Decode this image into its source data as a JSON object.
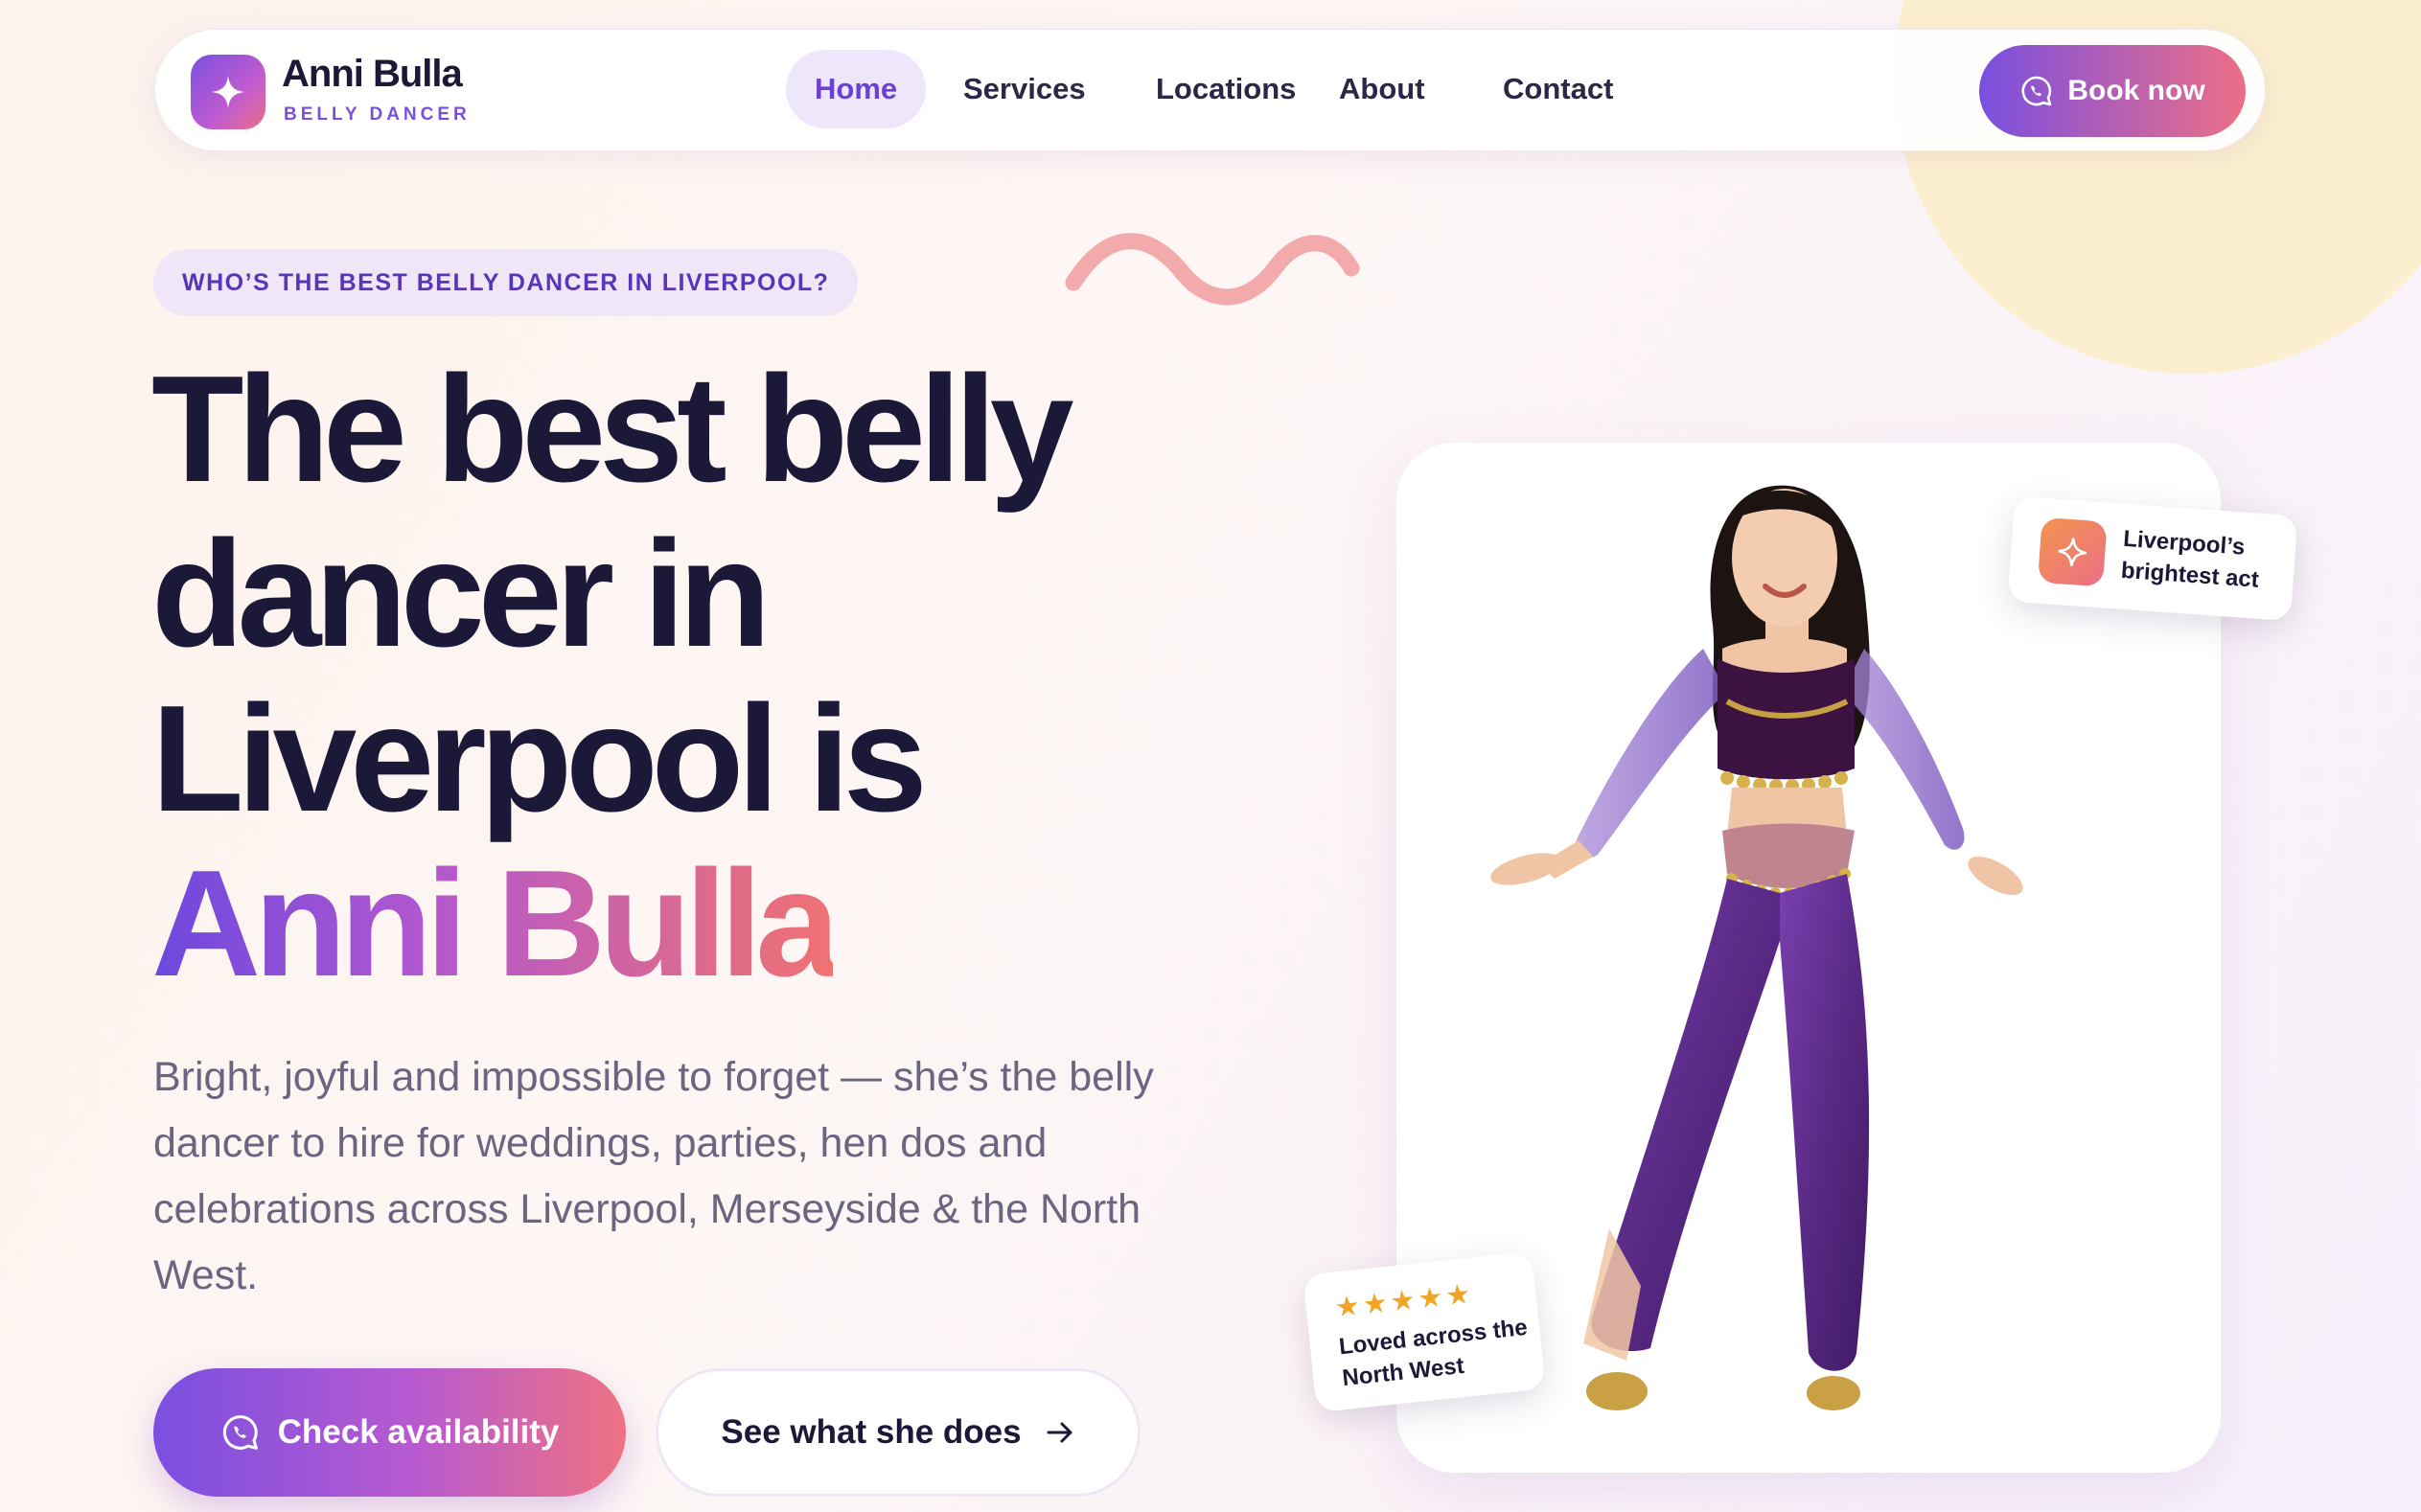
{
  "nav": {
    "brand_name": "Anni Bulla",
    "brand_sub": "BELLY DANCER",
    "links": [
      "Home",
      "Services",
      "Locations",
      "About",
      "Contact"
    ],
    "active": "Home",
    "book_label": "Book now"
  },
  "hero": {
    "eyebrow": "WHO’S THE BEST BELLY DANCER IN LIVERPOOL?",
    "headline_line1": "The best belly",
    "headline_line2": "dancer in",
    "headline_line3": "Liverpool is",
    "headline_highlight": "Anni Bulla",
    "lede": "Bright, joyful and impossible to forget — she’s the belly dancer to hire for weddings, parties, hen dos and celebrations across Liverpool, Merseyside & the North West.",
    "cta_primary": "Check availability",
    "cta_secondary": "See what she does"
  },
  "badges": {
    "top_text": "Liverpool’s brightest act",
    "bottom_stars": "★★★★★",
    "bottom_text": "Loved across the North West",
    "rating": 5
  },
  "colors": {
    "brand_purple": "#7a4fe0",
    "brand_coral": "#ec6f86",
    "ink": "#1c1838",
    "star": "#f2a427",
    "costume": "#5a2a86"
  },
  "icons": {
    "logo": "sparkle-icon",
    "book": "whatsapp-icon",
    "cta_primary": "whatsapp-icon",
    "cta_secondary": "arrow-right-icon",
    "badge_top": "sparkle-icon"
  }
}
